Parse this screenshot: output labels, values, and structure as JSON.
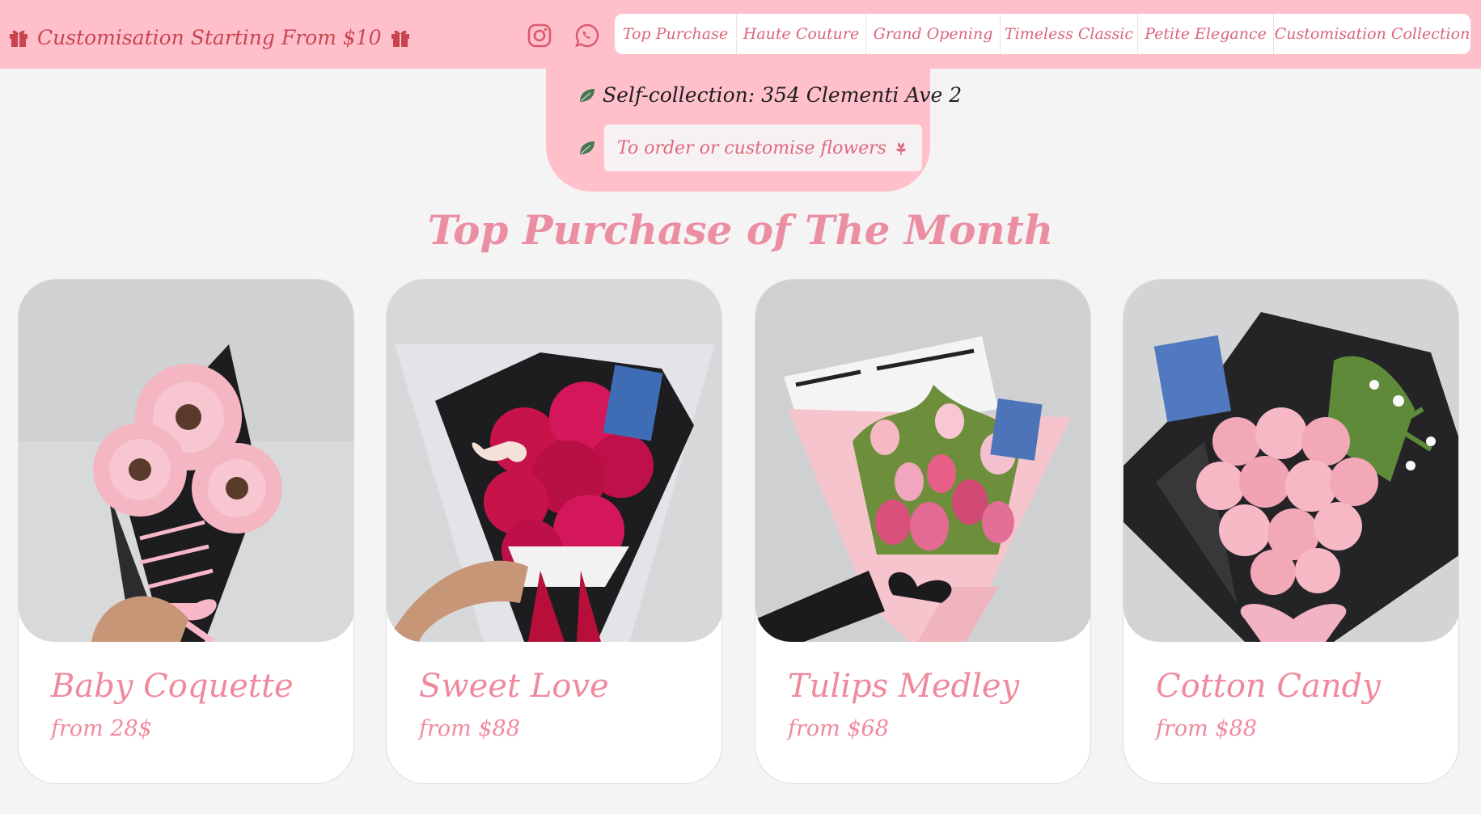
{
  "header": {
    "promo_text": "Customisation Starting From $10",
    "promo_icon": "gift-icon",
    "social_icons": [
      "instagram-icon",
      "whatsapp-icon"
    ],
    "nav": [
      {
        "label": "Top Purchase"
      },
      {
        "label": "Haute Couture"
      },
      {
        "label": "Grand Opening"
      },
      {
        "label": "Timeless Classic"
      },
      {
        "label": "Petite Elegance"
      },
      {
        "label": "Customisation Collection"
      }
    ]
  },
  "info": {
    "collection_text": "Self-collection: 354 Clementi Ave 2",
    "order_button": "To order or customise flowers",
    "order_icon": "flower-icon",
    "bullet_icon": "leaf-icon"
  },
  "section": {
    "title": "Top Purchase of The Month"
  },
  "products": [
    {
      "name": "Baby Coquette",
      "price": "from 28$"
    },
    {
      "name": "Sweet Love",
      "price": "from $88"
    },
    {
      "name": "Tulips Medley",
      "price": "from $68"
    },
    {
      "name": "Cotton Candy",
      "price": "from $88"
    }
  ],
  "colors": {
    "pink_bar": "#ffc0cb",
    "accent": "#ef8a9e",
    "promo_text": "#c8454f",
    "background": "#f4f4f4"
  }
}
